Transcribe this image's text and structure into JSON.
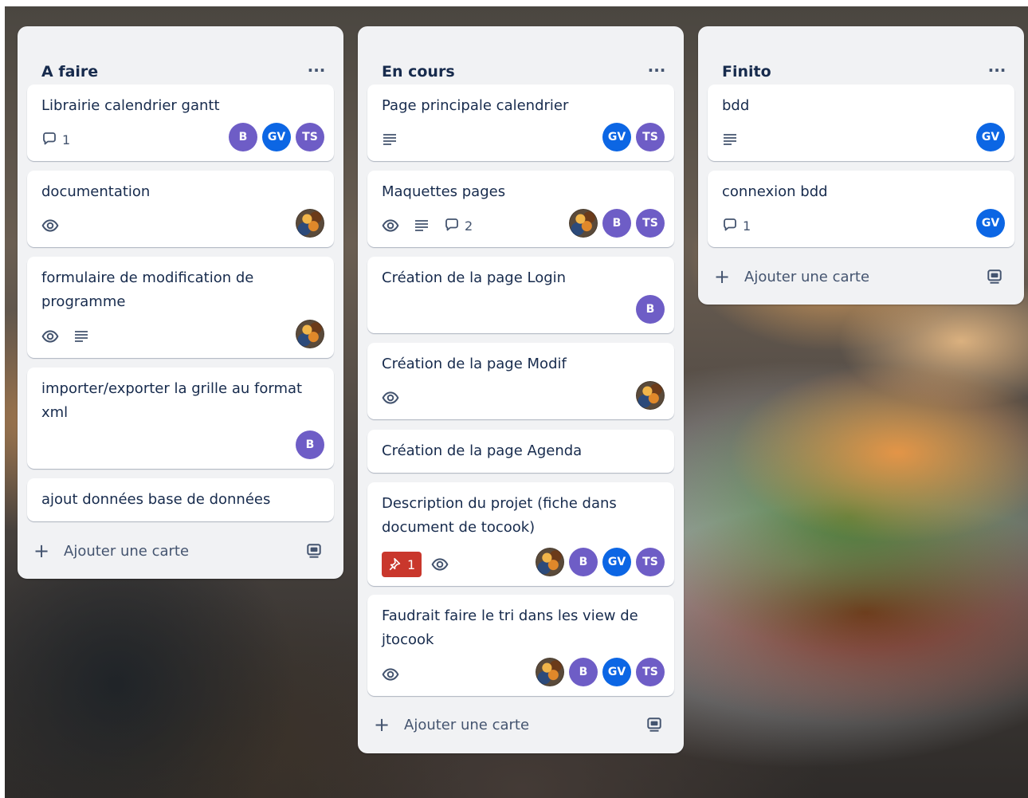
{
  "colors": {
    "list_bg": "#f1f2f4",
    "card_bg": "#ffffff",
    "text": "#172b4d",
    "muted": "#44546f",
    "avatar_B": "#6e5dc6",
    "avatar_GV": "#0c66e4",
    "avatar_TS": "#6e5dc6",
    "alert": "#c9372c"
  },
  "icons": {
    "more": "ellipsis-icon",
    "comment": "comment-icon",
    "description": "description-icon",
    "watch": "eye-icon",
    "checklist_alert": "pin-icon",
    "add": "plus-icon",
    "template": "card-template-icon"
  },
  "lists": [
    {
      "title": "A faire",
      "more_label": "···",
      "add_label": "Ajouter une carte",
      "cards": [
        {
          "title": "Librairie calendrier gantt",
          "comments": "1",
          "members": [
            "B",
            "GV",
            "TS"
          ]
        },
        {
          "title": "documentation",
          "members": [
            "photo"
          ]
        },
        {
          "title": "formulaire de modification de programme",
          "members": [
            "photo"
          ]
        },
        {
          "title": "importer/exporter la grille au format xml",
          "members": [
            "B"
          ]
        },
        {
          "title": "ajout données base de données"
        }
      ]
    },
    {
      "title": "En cours",
      "more_label": "···",
      "add_label": "Ajouter une carte",
      "cards": [
        {
          "title": "Page principale calendrier",
          "members": [
            "GV",
            "TS"
          ]
        },
        {
          "title": "Maquettes pages",
          "comments": "2",
          "members": [
            "photo",
            "B",
            "TS"
          ]
        },
        {
          "title": "Création de la page Login",
          "members": [
            "B"
          ]
        },
        {
          "title": "Création de la page Modif",
          "members": [
            "photo"
          ]
        },
        {
          "title": "Création de la page Agenda"
        },
        {
          "title": "Description du projet (fiche dans document de tocook)",
          "alert_count": "1",
          "members": [
            "photo",
            "B",
            "GV",
            "TS"
          ]
        },
        {
          "title": "Faudrait faire le tri dans les view de jtocook",
          "members": [
            "photo",
            "B",
            "GV",
            "TS"
          ]
        }
      ]
    },
    {
      "title": "Finito",
      "more_label": "···",
      "add_label": "Ajouter une carte",
      "cards": [
        {
          "title": "bdd",
          "members": [
            "GV"
          ]
        },
        {
          "title": "connexion bdd",
          "comments": "1",
          "members": [
            "GV"
          ]
        }
      ]
    }
  ],
  "avatars": {
    "B": "B",
    "GV": "GV",
    "TS": "TS"
  }
}
